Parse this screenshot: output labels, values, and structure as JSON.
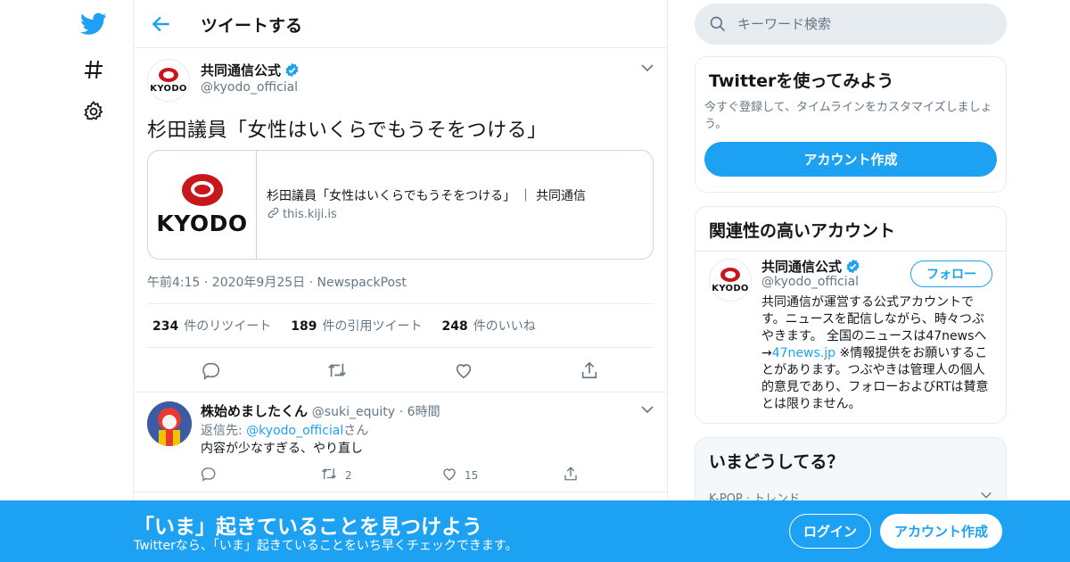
{
  "header": {
    "title": "ツイートする"
  },
  "tweet": {
    "author_name": "共同通信公式",
    "author_handle": "@kyodo_official",
    "avatar_logo_text": "KYODO",
    "text": "杉田議員「女性はいくらでもうそをつける」",
    "card": {
      "logo_text": "KYODO",
      "title": "杉田議員「女性はいくらでもうそをつける」 ｜ 共同通信",
      "link": "this.kiji.is"
    },
    "meta": "午前4:15 · 2020年9月25日 · NewspackPost",
    "stats": {
      "retweets_count": "234",
      "retweets_label": "件のリツイート",
      "quotes_count": "189",
      "quotes_label": "件の引用ツイート",
      "likes_count": "248",
      "likes_label": "件のいいね"
    }
  },
  "reply": {
    "name": "株始めましたくん",
    "handle": "@suki_equity",
    "time": "· 6時間",
    "reply_to_prefix": "返信先: ",
    "reply_to_handle": "@kyodo_official",
    "reply_to_suffix": "さん",
    "text": "内容が少なすぎる、やり直し",
    "retweets": "2",
    "likes": "15"
  },
  "search": {
    "placeholder": "キーワード検索"
  },
  "try_panel": {
    "title": "Twitterを使ってみよう",
    "description": "今すぐ登録して、タイムラインをカスタマイズしましょう。",
    "button": "アカウント作成"
  },
  "related": {
    "title": "関連性の高いアカウント",
    "name": "共同通信公式",
    "handle": "@kyodo_official",
    "avatar_logo_text": "KYODO",
    "follow": "フォロー",
    "bio_part1": "共同通信が運営する公式アカウントです。ニュースを配信しながら、時々つぶやきます。 全国のニュースは47newsへ →",
    "bio_link": "47news.jp",
    "bio_part2": " ※情報提供をお願いすることがあります。つぶやきは管理人の個人的意見であり、フォローおよびRTは賛意とは限りません。"
  },
  "trends": {
    "title": "いまどうしてる？",
    "first_meta": "K-POP · トレンド"
  },
  "banner": {
    "title": "「いま」起きていることを見つけよう",
    "subtitle": "Twitterなら、「いま」起きていることをいち早くチェックできます。",
    "login": "ログイン",
    "signup": "アカウント作成"
  },
  "colors": {
    "brand": "#1da1f2",
    "text": "#14171a",
    "secondary": "#657786",
    "border": "#e6ecf0",
    "kyodo_red": "#c8161d"
  },
  "icons": [
    "twitter-bird-icon",
    "hashtag-icon",
    "gear-icon",
    "back-arrow-icon",
    "verified-icon",
    "chevron-down-icon",
    "link-icon",
    "reply-icon",
    "retweet-icon",
    "like-icon",
    "share-icon",
    "search-icon"
  ]
}
